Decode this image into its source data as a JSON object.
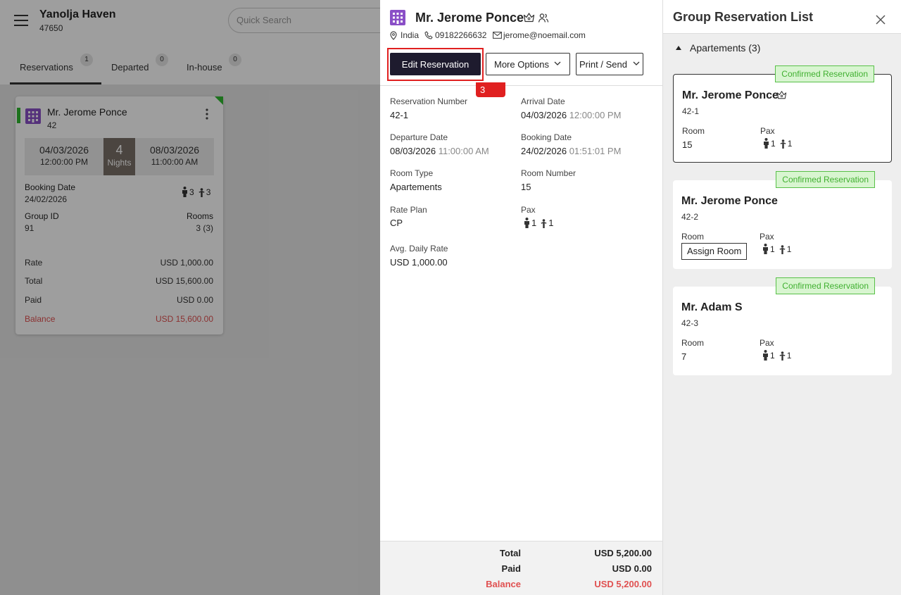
{
  "app": {
    "hotel_name": "Yanolja Haven",
    "hotel_id": "47650",
    "search_placeholder": "Quick Search"
  },
  "tabs": [
    {
      "label": "Reservations",
      "count": "1"
    },
    {
      "label": "Departed",
      "count": "0"
    },
    {
      "label": "In-house",
      "count": "0"
    }
  ],
  "res_card": {
    "guest": "Mr. Jerome Ponce",
    "number": "42",
    "arrival_date": "04/03/2026",
    "arrival_time": "12:00:00 PM",
    "nights": "4",
    "nights_label": "Nights",
    "departure_date": "08/03/2026",
    "departure_time": "11:00:00 AM",
    "booking_date_label": "Booking Date",
    "booking_date": "24/02/2026",
    "adults": "3",
    "children": "3",
    "group_id_label": "Group ID",
    "group_id": "91",
    "rooms_label": "Rooms",
    "rooms": "3 (3)",
    "rate_label": "Rate",
    "rate": "USD 1,000.00",
    "total_label": "Total",
    "total": "USD 15,600.00",
    "paid_label": "Paid",
    "paid": "USD 0.00",
    "balance_label": "Balance",
    "balance": "USD 15,600.00",
    "status_color": "#2fb82f"
  },
  "detail": {
    "guest": "Mr. Jerome Ponce",
    "country": "India",
    "phone": "09182266632",
    "email": "jerome@noemail.com",
    "edit_label": "Edit Reservation",
    "more_label": "More Options",
    "print_label": "Print / Send",
    "step_badge": "3",
    "fields": {
      "res_number_label": "Reservation Number",
      "res_number": "42-1",
      "arrival_label": "Arrival Date",
      "arrival_date": "04/03/2026",
      "arrival_time": "12:00:00 PM",
      "departure_label": "Departure Date",
      "departure_date": "08/03/2026",
      "departure_time": "11:00:00 AM",
      "booking_label": "Booking Date",
      "booking_date": "24/02/2026",
      "booking_time": "01:51:01 PM",
      "room_type_label": "Room Type",
      "room_type": "Apartements",
      "room_number_label": "Room Number",
      "room_number": "15",
      "rate_plan_label": "Rate Plan",
      "rate_plan": "CP",
      "pax_label": "Pax",
      "pax_adults": "1",
      "pax_children": "1",
      "adr_label": "Avg. Daily Rate",
      "adr": "USD 1,000.00"
    },
    "footer": {
      "total_label": "Total",
      "total": "USD 5,200.00",
      "paid_label": "Paid",
      "paid": "USD 0.00",
      "balance_label": "Balance",
      "balance": "USD 5,200.00"
    }
  },
  "group_list": {
    "title": "Group Reservation List",
    "section": "Apartements (3)",
    "room_label": "Room",
    "pax_label": "Pax",
    "items": [
      {
        "status": "Confirmed Reservation",
        "guest": "Mr. Jerome Ponce",
        "id": "42-1",
        "room": "15",
        "adults": "1",
        "children": "1"
      },
      {
        "status": "Confirmed Reservation",
        "guest": "Mr. Jerome Ponce",
        "id": "42-2",
        "assign_label": "Assign Room",
        "adults": "1",
        "children": "1"
      },
      {
        "status": "Confirmed Reservation",
        "guest": "Mr. Adam S",
        "id": "42-3",
        "room": "7",
        "adults": "1",
        "children": "1"
      }
    ]
  },
  "colors": {
    "accent_dark": "#1e1b2e",
    "confirmed": "#40b030",
    "balance_red": "#e05050",
    "brand_purple": "#8a4fc7"
  }
}
